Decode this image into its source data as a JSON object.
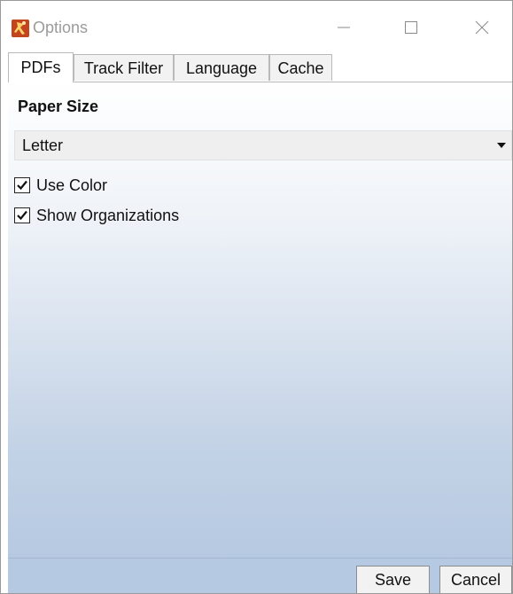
{
  "window": {
    "title": "Options",
    "controls": {
      "minimize": "minimize",
      "maximize": "maximize",
      "close": "close"
    }
  },
  "tabs": [
    {
      "label": "PDFs",
      "active": true
    },
    {
      "label": "Track Filter",
      "active": false
    },
    {
      "label": "Language",
      "active": false
    },
    {
      "label": "Cache",
      "active": false
    }
  ],
  "pdfs": {
    "section_title": "Paper Size",
    "paper_size": {
      "value": "Letter"
    },
    "checkboxes": [
      {
        "label": "Use Color",
        "checked": true
      },
      {
        "label": "Show Organizations",
        "checked": true
      }
    ]
  },
  "footer": {
    "save_label": "Save",
    "cancel_label": "Cancel"
  },
  "icons": {
    "app": "app-logo-icon",
    "dropdown": "caret-down-icon",
    "check": "checkmark-icon"
  },
  "colors": {
    "app_icon": "#c2451e",
    "gradient_bottom": "#b6c9e2"
  }
}
